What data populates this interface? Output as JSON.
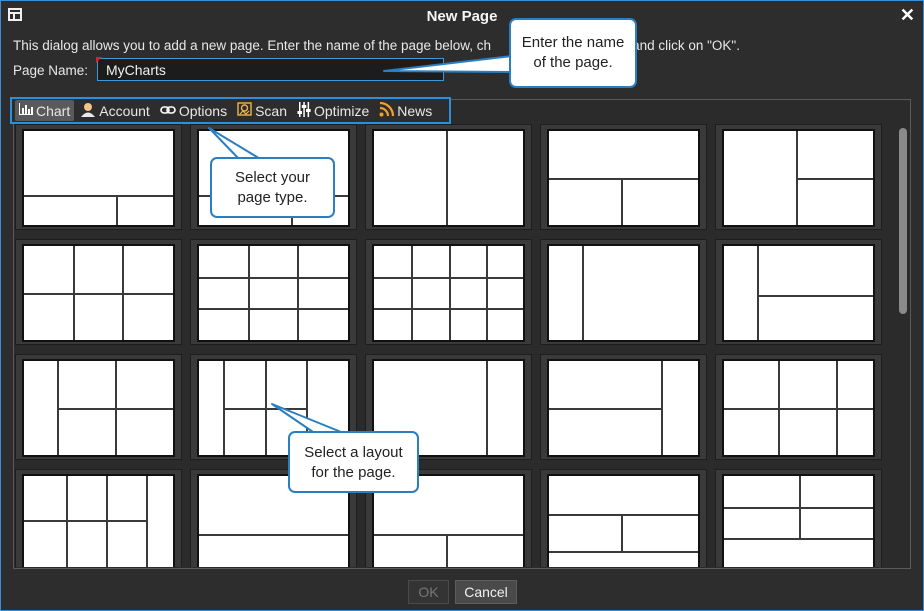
{
  "window": {
    "title": "New Page"
  },
  "description": "This dialog allows you to add a new page.  Enter the name of the page below, ch",
  "description_tail": "elow) and click on \"OK\".",
  "page_name": {
    "label": "Page Name:",
    "value": "MyCharts"
  },
  "tabs": [
    {
      "label": "Chart",
      "icon": "bar-chart-icon"
    },
    {
      "label": "Account",
      "icon": "user-icon"
    },
    {
      "label": "Options",
      "icon": "link-icon"
    },
    {
      "label": "Scan",
      "icon": "scan-icon"
    },
    {
      "label": "Optimize",
      "icon": "sliders-icon"
    },
    {
      "label": "News",
      "icon": "rss-icon"
    }
  ],
  "active_tab": "Chart",
  "buttons": {
    "ok": "OK",
    "cancel": "Cancel"
  },
  "callouts": {
    "name": {
      "line1": "Enter the name",
      "line2": "of the page."
    },
    "type": {
      "line1": "Select your",
      "line2": "page type."
    },
    "layout": {
      "line1": "Select a layout",
      "line2": "for the page."
    }
  },
  "colors": {
    "accent": "#2b8fd9",
    "background": "#2d2d2d",
    "thumbnail": "#ffffff"
  }
}
